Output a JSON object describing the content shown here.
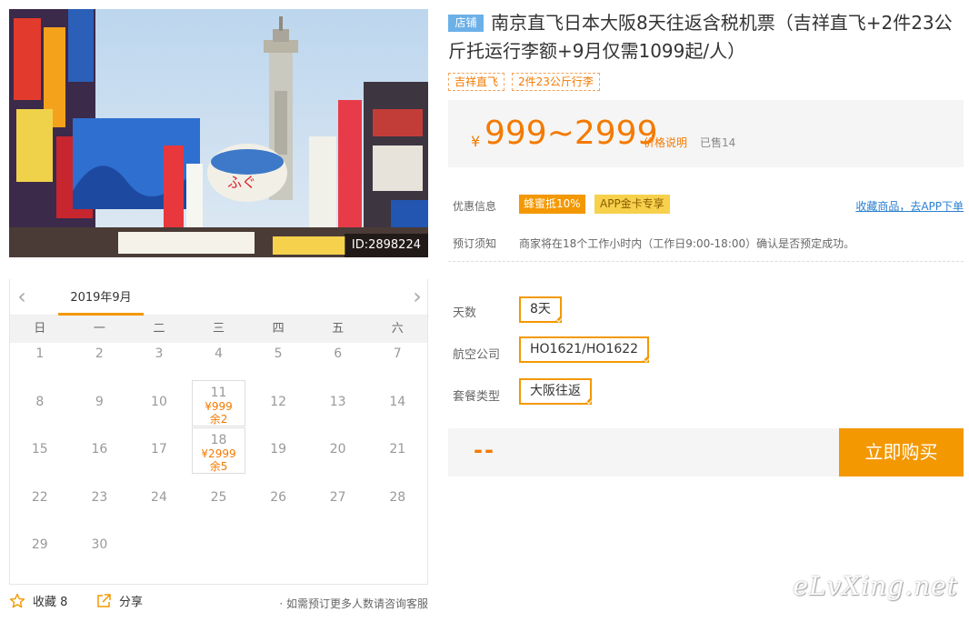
{
  "gallery": {
    "image_alt": "大阪新世界通天阁街景",
    "id_label": "ID:2898224"
  },
  "calendar": {
    "prev_icon": "chevron-left-icon",
    "next_icon": "chevron-right-icon",
    "month": "2019年9月",
    "weekdays": [
      "日",
      "一",
      "二",
      "三",
      "四",
      "五",
      "六"
    ],
    "weeks": [
      [
        {
          "day": "1"
        },
        {
          "day": "2"
        },
        {
          "day": "3"
        },
        {
          "day": "4"
        },
        {
          "day": "5"
        },
        {
          "day": "6"
        },
        {
          "day": "7"
        }
      ],
      [
        {
          "day": "8"
        },
        {
          "day": "9"
        },
        {
          "day": "10"
        },
        {
          "day": "11",
          "price": "¥999",
          "stock": "余2"
        },
        {
          "day": "12"
        },
        {
          "day": "13"
        },
        {
          "day": "14"
        }
      ],
      [
        {
          "day": "15"
        },
        {
          "day": "16"
        },
        {
          "day": "17"
        },
        {
          "day": "18",
          "price": "¥2999",
          "stock": "余5"
        },
        {
          "day": "19"
        },
        {
          "day": "20"
        },
        {
          "day": "21"
        }
      ],
      [
        {
          "day": "22"
        },
        {
          "day": "23"
        },
        {
          "day": "24"
        },
        {
          "day": "25"
        },
        {
          "day": "26"
        },
        {
          "day": "27"
        },
        {
          "day": "28"
        }
      ],
      [
        {
          "day": "29"
        },
        {
          "day": "30"
        },
        {
          "day": ""
        },
        {
          "day": ""
        },
        {
          "day": ""
        },
        {
          "day": ""
        },
        {
          "day": ""
        }
      ]
    ]
  },
  "actions": {
    "favorite_label": "收藏 8",
    "share_label": "分享",
    "note": "· 如需预订更多人数请咨询客服"
  },
  "product": {
    "shop_badge": "店铺",
    "title": "南京直飞日本大阪8天往返含税机票（吉祥直飞+2件23公斤托运行李额+9月仅需1099起/人）",
    "tags": [
      "吉祥直飞",
      "2件23公斤行李"
    ],
    "price_symbol": "¥",
    "price_range": "999~2999",
    "price_explain": "价格说明",
    "sold": "已售14"
  },
  "info": {
    "promo_label": "优惠信息",
    "promo_tags": [
      "蜂蜜抵10%",
      "APP金卡专享"
    ],
    "app_link": "收藏商品，去APP下单",
    "notice_label": "预订须知",
    "notice_text": "商家将在18个工作小时内（工作日9:00-18:00）确认是否预定成功。"
  },
  "options": [
    {
      "label": "天数",
      "value": "8天"
    },
    {
      "label": "航空公司",
      "value": "HO1621/HO1622"
    },
    {
      "label": "套餐类型",
      "value": "大阪往返"
    }
  ],
  "purchase": {
    "total": "--",
    "buy_label": "立即购买"
  },
  "watermark": "eLvXing.net",
  "colors": {
    "accent": "#f39800",
    "price": "#f37a00",
    "link": "#2a7fd0",
    "shop_badge": "#6cb0e8"
  }
}
